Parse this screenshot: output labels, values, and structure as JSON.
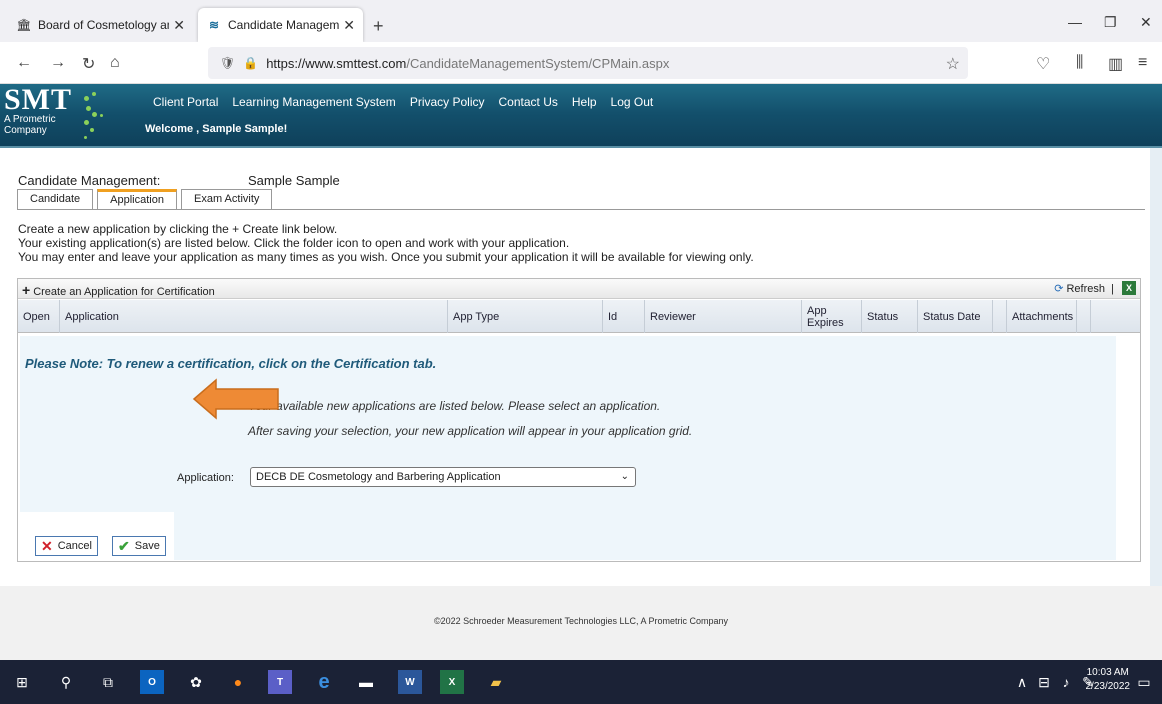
{
  "browser": {
    "tabs": [
      {
        "label": "Board of Cosmetology and Barb",
        "active": false
      },
      {
        "label": "Candidate Management System",
        "active": true
      }
    ],
    "url_domain": "https://www.smttest.com",
    "url_path": "/CandidateManagementSystem/CPMain.aspx"
  },
  "site": {
    "logo_text": "SMT",
    "logo_sub1": "A Prometric",
    "logo_sub2": "Company",
    "nav": [
      "Client Portal",
      "Learning Management System",
      "Privacy Policy",
      "Contact Us",
      "Help",
      "Log Out"
    ],
    "welcome": "Welcome , Sample Sample!"
  },
  "page": {
    "cm_label": "Candidate Management:",
    "candidate_name": "Sample Sample",
    "tabs": [
      "Candidate",
      "Application",
      "Exam Activity"
    ],
    "intro": [
      "Create a new application by clicking the + Create link below.",
      "Your existing application(s) are listed below. Click the folder icon to open and work with your application.",
      "You may enter and leave your application as many times as you wish. Once you submit your application it will be available for viewing only."
    ],
    "create_link": "Create an Application for Certification",
    "refresh": "Refresh",
    "columns": [
      "Open",
      "Application",
      "App Type",
      "Id",
      "Reviewer",
      "App Expires",
      "Status",
      "Status Date",
      "Attachments"
    ],
    "note": "Please Note: To renew a certification, click on the Certification tab.",
    "info1": "Your available new applications are listed below. Please select an application.",
    "info2": "After saving your selection, your new application will appear in your application grid.",
    "app_label": "Application:",
    "app_selected": "DECB DE Cosmetology and Barbering Application",
    "cancel": "Cancel",
    "save": "Save"
  },
  "footer": {
    "copyright": "©2022 Schroeder Measurement Technologies LLC, A Prometric Company"
  },
  "taskbar": {
    "time": "10:03 AM",
    "date": "2/23/2022"
  },
  "colors": {
    "header": "#13506c",
    "accent_arrow": "#e8832a",
    "panel": "#eef6fb"
  }
}
